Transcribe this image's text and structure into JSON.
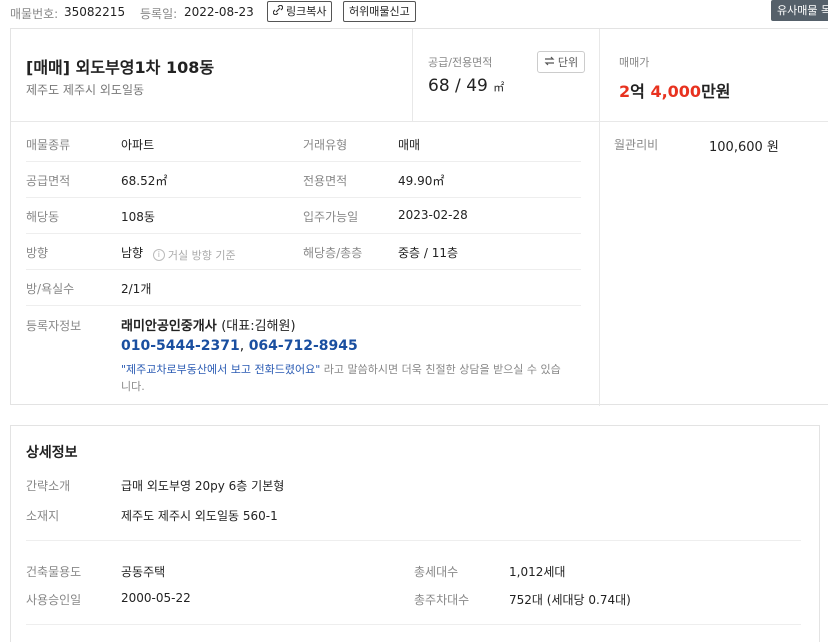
{
  "topbar": {
    "listing_no_label": "매물번호:",
    "listing_no": "35082215",
    "reg_date_label": "등록일:",
    "reg_date": "2022-08-23",
    "copy_link_label": "링크복사",
    "report_label": "허위매물신고",
    "similar_label": "유사매물 목"
  },
  "summary": {
    "title": "[매매] 외도부영1차 108동",
    "address": "제주도 제주시 외도일동",
    "area_label": "공급/전용면적",
    "supply_area": "68",
    "exclusive_area": "49",
    "area_unit": "㎡",
    "unit_button_label": "단위",
    "price_label": "매매가",
    "price_eok_num": "2",
    "price_eok": "억",
    "price_man_num": "4,000",
    "price_man": "만원"
  },
  "details": {
    "property_type_label": "매물종류",
    "property_type": "아파트",
    "deal_type_label": "거래유형",
    "deal_type": "매매",
    "supply_area_label": "공급면적",
    "supply_area": "68.52㎡",
    "exclusive_area_label": "전용면적",
    "exclusive_area": "49.90㎡",
    "building_label": "해당동",
    "building": "108동",
    "movein_label": "입주가능일",
    "movein": "2023-02-28",
    "direction_label": "방향",
    "direction": "남향",
    "direction_hint": "거실 방향 기준",
    "floor_label": "해당층/총층",
    "floor": "중층 / 11층",
    "rooms_label": "방/욕실수",
    "rooms": "2/1개",
    "agent_label": "등록자정보",
    "agent_name": "래미안공인중개사",
    "agent_rep": "(대표:김해원)",
    "phone1": "010-5444-2371",
    "phone2": "064-712-8945",
    "note_quote": "\"제주교차로부동산에서 보고 전화드렸어요\"",
    "note_rest": "라고 말씀하시면 더욱 친절한 상담을 받으실 수 있습니다."
  },
  "side": {
    "maintenance_label": "월관리비",
    "maintenance": "100,600 원"
  },
  "detail_info": {
    "title": "상세정보",
    "intro_label": "간략소개",
    "intro": "급매 외도부영 20py 6층 기본형",
    "location_label": "소재지",
    "location": "제주도 제주시 외도일동 560-1",
    "usage_label": "건축물용도",
    "usage": "공동주택",
    "households_label": "총세대수",
    "households": "1,012세대",
    "approval_label": "사용승인일",
    "approval": "2000-05-22",
    "parking_label": "총주차대수",
    "parking": "752대 (세대당 0.74대)"
  },
  "colors": {
    "price_red": "#e8321f",
    "phone_blue": "#1a4fa0",
    "dark_button": "#55606a"
  }
}
